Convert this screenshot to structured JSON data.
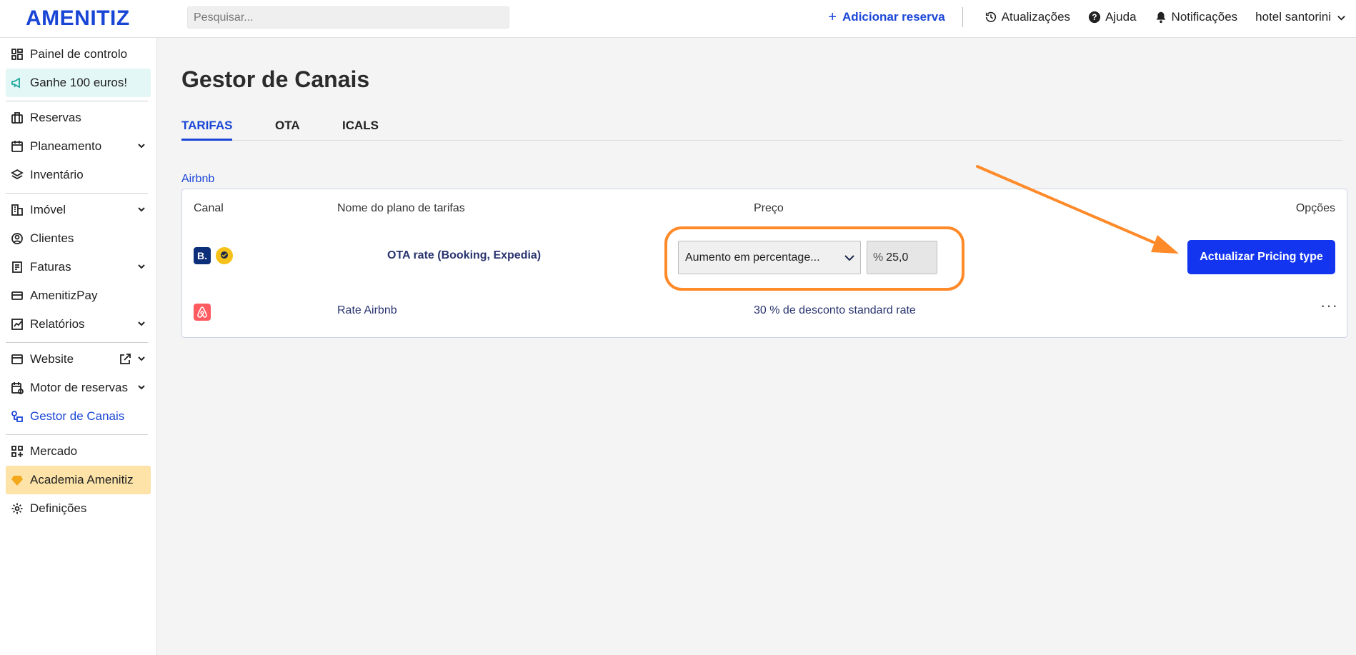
{
  "app": {
    "logo": "AMENITIZ",
    "search_placeholder": "Pesquisar...",
    "add_reservation": "Adicionar reserva",
    "updates": "Atualizações",
    "help": "Ajuda",
    "notifications": "Notificações",
    "hotel_name": "hotel santorini"
  },
  "sidebar": {
    "items": [
      {
        "label": "Painel de controlo",
        "icon": "dashboard-icon"
      },
      {
        "label": "Ganhe 100 euros!",
        "icon": "megaphone-icon"
      },
      {
        "label": "Reservas",
        "icon": "suitcase-icon"
      },
      {
        "label": "Planeamento",
        "icon": "calendar-icon"
      },
      {
        "label": "Inventário",
        "icon": "layers-icon"
      },
      {
        "label": "Imóvel",
        "icon": "building-icon"
      },
      {
        "label": "Clientes",
        "icon": "users-icon"
      },
      {
        "label": "Faturas",
        "icon": "invoice-icon"
      },
      {
        "label": "AmenitizPay",
        "icon": "card-icon"
      },
      {
        "label": "Relatórios",
        "icon": "chart-icon"
      },
      {
        "label": "Website",
        "icon": "browser-icon"
      },
      {
        "label": "Motor de reservas",
        "icon": "calendar-check-icon"
      },
      {
        "label": "Gestor de Canais",
        "icon": "channels-icon"
      },
      {
        "label": "Mercado",
        "icon": "apps-icon"
      },
      {
        "label": "Academia Amenitiz",
        "icon": "diamond-icon"
      },
      {
        "label": "Definições",
        "icon": "gear-icon"
      }
    ]
  },
  "main": {
    "title": "Gestor de Canais",
    "tabs": [
      "TARIFAS",
      "OTA",
      "ICALS"
    ],
    "section": "Airbnb",
    "table": {
      "headers": {
        "channel": "Canal",
        "plan": "Nome do plano de tarifas",
        "price": "Preço",
        "options": "Opções"
      },
      "rows": [
        {
          "plan": "OTA rate (Booking, Expedia)",
          "pricing_select": "Aumento em percentage...",
          "percent_unit": "%",
          "percent_value": "25,0",
          "action": "Actualizar Pricing type"
        },
        {
          "plan": "Rate Airbnb",
          "price": "30 % de desconto standard rate",
          "options": "···"
        }
      ]
    }
  },
  "colors": {
    "accent": "#1a46d6",
    "button": "#1435f0",
    "highlight": "#ff8a2a"
  }
}
